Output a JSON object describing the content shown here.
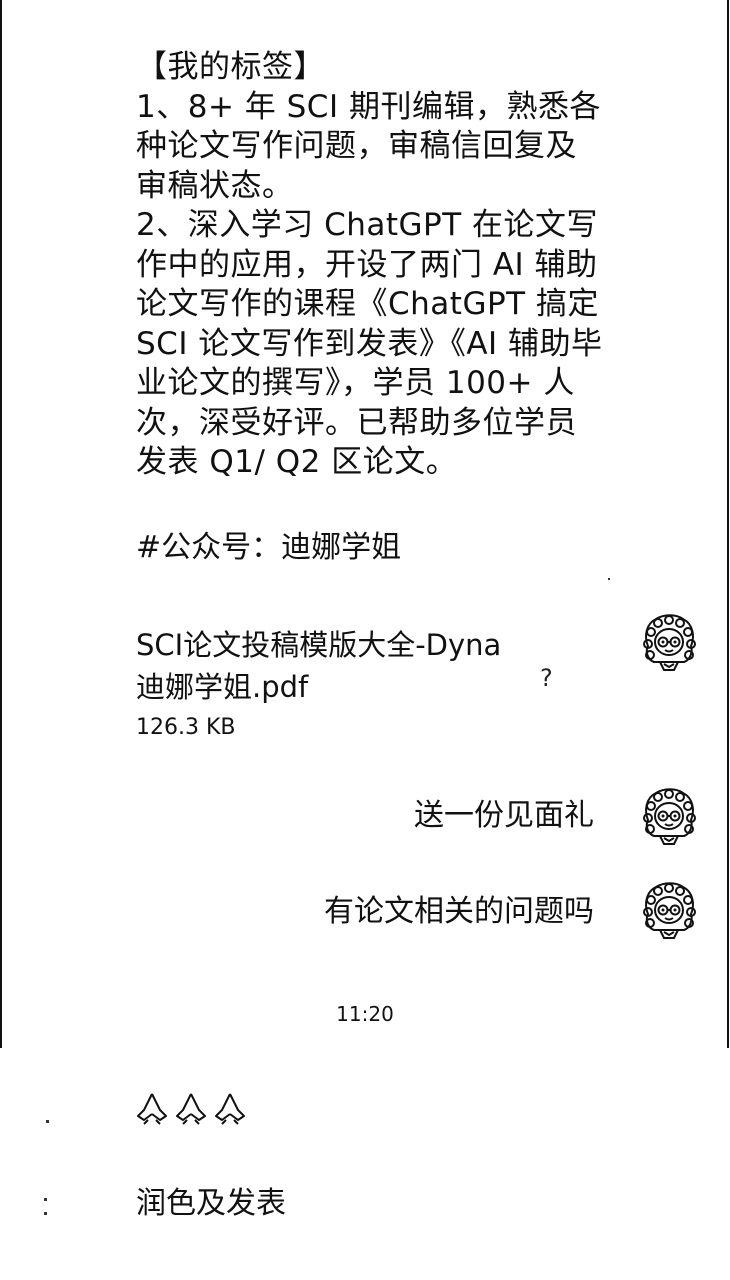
{
  "bio": {
    "lines": [
      "【我的标签】",
      "1、8+ 年 SCI 期刊编辑，熟悉各种论文写作问题，审稿信回复及审稿状态。",
      "2、深入学习 ChatGPT 在论文写作中的应用，开设了两门 AI 辅助论文写作的课程《ChatGPT 搞定 SCI 论文写作到发表》《AI 辅助毕业论文的撰写》，学员 100+ 人次，深受好评。已帮助多位学员发表 Q1/ Q2 区论文。"
    ],
    "hashtag": "#公众号：迪娜学姐"
  },
  "file_message": {
    "name": "SCI论文投稿模版大全-Dyna迪娜学姐.pdf",
    "size": "126.3 KB",
    "status_icon": "question-mark-icon",
    "status_text": "?"
  },
  "messages": [
    {
      "text": "送一份见面礼"
    },
    {
      "text": "有论文相关的问题吗"
    }
  ],
  "timestamp": "11:20",
  "replies": {
    "emoji_icon": "praying-hands-icon",
    "emoji_count": 3,
    "text": "润色及发表"
  },
  "colors": {
    "background": "#ffffff",
    "text": "#111111"
  }
}
